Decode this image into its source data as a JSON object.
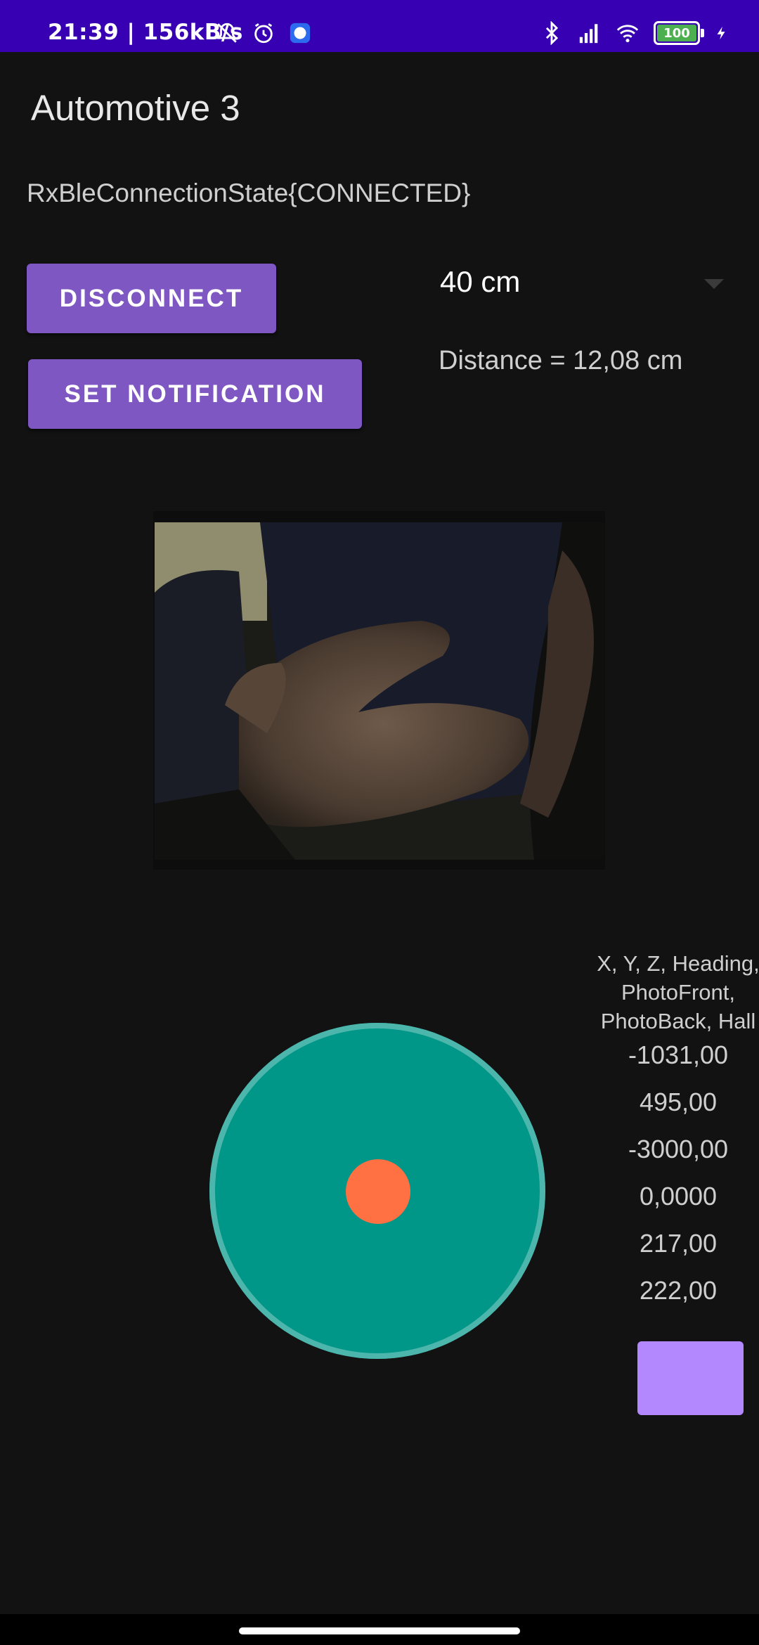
{
  "status_bar": {
    "time_speed": "21:39 | 156kB/s",
    "icons": [
      "mute-bell-icon",
      "alarm-icon",
      "signal-app-icon",
      "bluetooth-icon",
      "cell-signal-icon",
      "wifi-icon",
      "battery-icon",
      "charging-icon"
    ],
    "battery": "100",
    "color": "#3700B3"
  },
  "app": {
    "title": "Automotive 3",
    "connection_state": "RxBleConnectionState{CONNECTED}"
  },
  "buttons": {
    "disconnect": "DISCONNECT",
    "set_notification": "SET NOTIFICATION",
    "accent": "#7E57C2"
  },
  "spinner": {
    "selected": "40 cm"
  },
  "distance": "Distance = 12,08 cm",
  "camera": {
    "icon": "camera-preview-image"
  },
  "joystick": {
    "base_color": "#009688",
    "border_color": "#4DB6AC",
    "knob_color": "#FF7043"
  },
  "readings": {
    "header": [
      "X, Y, Z, Heading,",
      "PhotoFront,",
      "PhotoBack, Hall"
    ],
    "values": [
      "-1031,00",
      "495,00",
      "-3000,00",
      "0,0000",
      "217,00",
      "222,00"
    ]
  },
  "indicator": {
    "color": "#B388FF"
  }
}
